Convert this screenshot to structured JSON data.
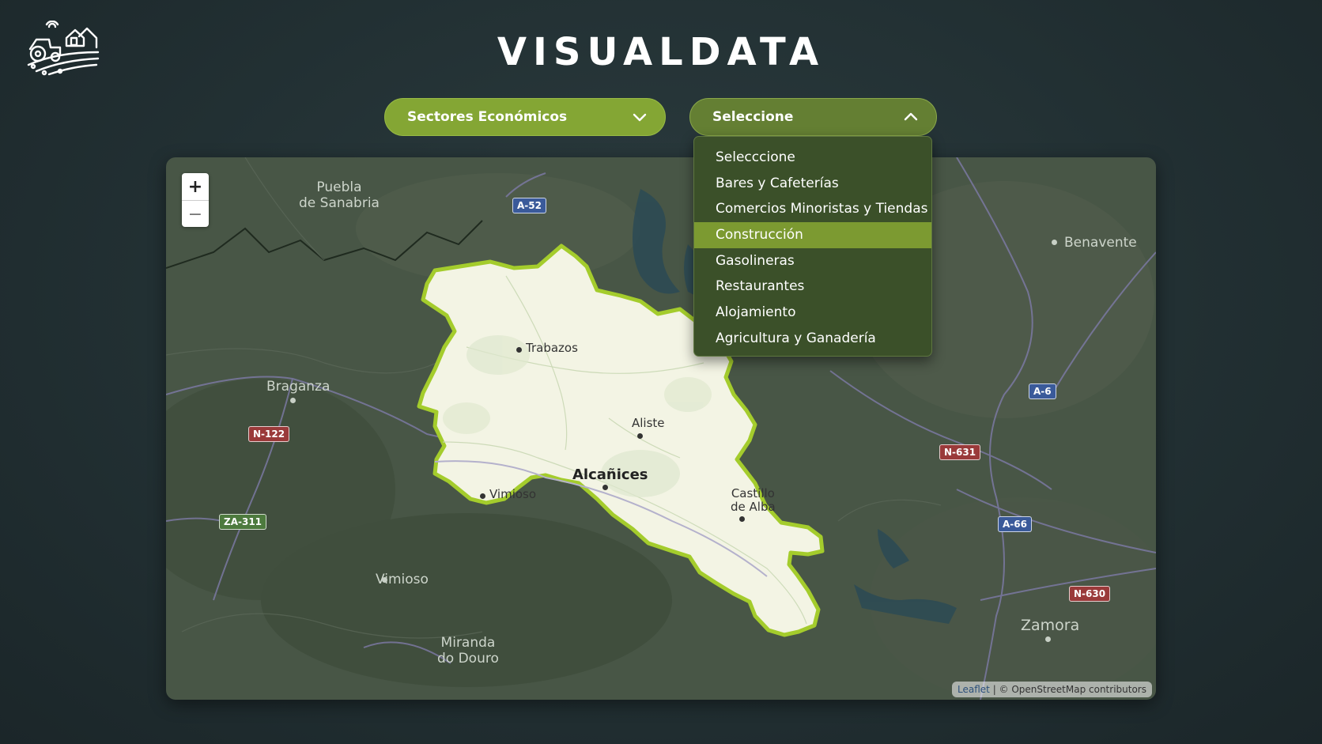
{
  "header": {
    "title": "VISUALDATA"
  },
  "filters": {
    "sector": {
      "label": "Sectores Económicos",
      "icon": "chevron-down-icon"
    },
    "subsector": {
      "label": "Seleccione",
      "icon": "chevron-up-icon",
      "open": true
    }
  },
  "dropdown": {
    "options": [
      "Selecccione",
      "Bares y Cafeterías",
      "Comercios Minoristas y Tiendas",
      "Construcción",
      "Gasolineras",
      "Restaurantes",
      "Alojamiento",
      "Agricultura y Ganadería"
    ],
    "highlighted": "Construcción"
  },
  "map": {
    "zoom_in": "+",
    "zoom_out": "−",
    "attribution_link": "Leaflet",
    "attribution_text": " | © OpenStreetMap contributors",
    "region_fill": "#f4f5e6",
    "region_border": "#a4cc2c",
    "labels": {
      "puebla_1": "Puebla",
      "puebla_2": "de Sanabria",
      "braganza": "Braganza",
      "vimioso_outer": "Vimioso",
      "miranda_1": "Miranda",
      "miranda_2": "do Douro",
      "benavente": "Benavente",
      "zamora": "Zamora",
      "trabazos": "Trabazos",
      "aliste": "Aliste",
      "alcanices": "Alcañices",
      "vimioso_inner": "Vimioso",
      "castillo_1": "Castillo",
      "castillo_2": "de Alba"
    },
    "roads": {
      "a52": "A-52",
      "n122": "N-122",
      "za311": "ZA-311",
      "a6": "A-6",
      "n631": "N-631",
      "a66": "A-66",
      "n630": "N-630"
    }
  }
}
